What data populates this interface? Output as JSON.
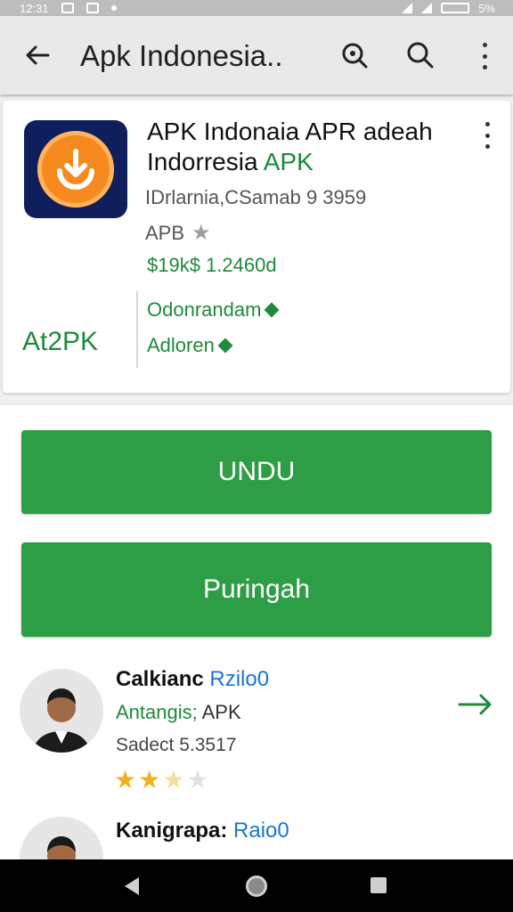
{
  "status_bar": {
    "time": "12:31",
    "battery": "5%"
  },
  "toolbar": {
    "title": "Apk Indonesia..",
    "icons": [
      "back-arrow-icon",
      "zoom-search-icon",
      "search-icon",
      "more-vert-icon"
    ]
  },
  "app_card": {
    "title": "APK Indonaia APR adeah",
    "developer_prefix": "Indorresia ",
    "developer_name": "APK",
    "meta": "IDrlarnia,CSamab 9 3959",
    "rating_label": "APB",
    "price": "$19k$ 1.2460d",
    "logo_text": "At2PK",
    "links": [
      "Odonrandam",
      "Adloren"
    ],
    "icon_name": "download-app-icon"
  },
  "buttons": {
    "primary": "UNDU",
    "secondary": "Puringah"
  },
  "reviews": [
    {
      "name": "Calkianc",
      "tag": "Rzilo0",
      "sub_green": "Antangis;",
      "sub_plain": " APK",
      "date": "Sadect 5.3517",
      "rating": 2.5
    },
    {
      "name": "Kanigrapa:",
      "tag": "Raio0"
    }
  ],
  "colors": {
    "accent_green": "#2e9e46",
    "link_blue": "#1976d2",
    "star_gold": "#f2b01e"
  }
}
